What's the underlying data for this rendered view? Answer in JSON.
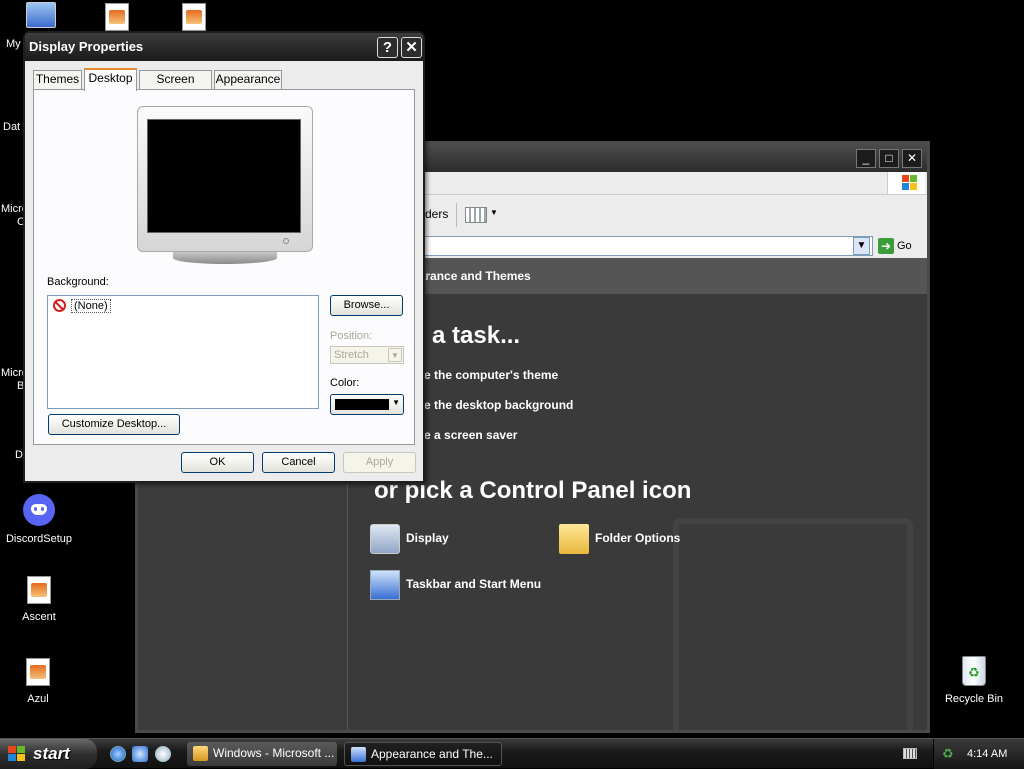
{
  "desktop": {
    "icons": [
      {
        "label": "DiscordSetup",
        "icon": "discord-icon"
      },
      {
        "label": "Ascent",
        "icon": "file-icon"
      },
      {
        "label": "Azul",
        "icon": "file-icon"
      },
      {
        "label": "Recycle Bin",
        "icon": "recycle-bin-icon"
      }
    ],
    "partial_labels": [
      "My",
      "Dat",
      "Micro",
      "C",
      "Micro",
      "B",
      "D"
    ]
  },
  "cp_window": {
    "toolbar_folders": "ders",
    "address_go": "Go",
    "category": "earance and Themes",
    "pick_task": "k a task...",
    "tasks": [
      "e the computer's theme",
      "e the desktop background",
      "e a screen saver"
    ],
    "pick_icon": "or pick a Control Panel icon",
    "icons": [
      {
        "label": "Display",
        "icon": "display-icon"
      },
      {
        "label": "Folder Options",
        "icon": "folder-options-icon"
      },
      {
        "label": "Taskbar and Start Menu",
        "icon": "taskbar-icon"
      }
    ]
  },
  "dialog": {
    "title": "Display Properties",
    "help_glyph": "?",
    "close_glyph": "✕",
    "tabs": [
      "Themes",
      "Desktop",
      "Screen Saver",
      "Appearance"
    ],
    "active_tab": "Desktop",
    "background_label": "Background:",
    "background_items": [
      "(None)"
    ],
    "browse_button": "Browse...",
    "position_label": "Position:",
    "position_value": "Stretch",
    "color_label": "Color:",
    "color_value": "#000000",
    "customize_button": "Customize Desktop...",
    "ok_button": "OK",
    "cancel_button": "Cancel",
    "apply_button": "Apply"
  },
  "taskbar": {
    "start_label": "start",
    "tasks": [
      {
        "label": "Windows - Microsoft ...",
        "active": false
      },
      {
        "label": "Appearance and The...",
        "active": true
      }
    ],
    "clock": "4:14 AM"
  },
  "colors": {
    "accent_tab": "#e68b2c",
    "button_border": "#003c74"
  }
}
